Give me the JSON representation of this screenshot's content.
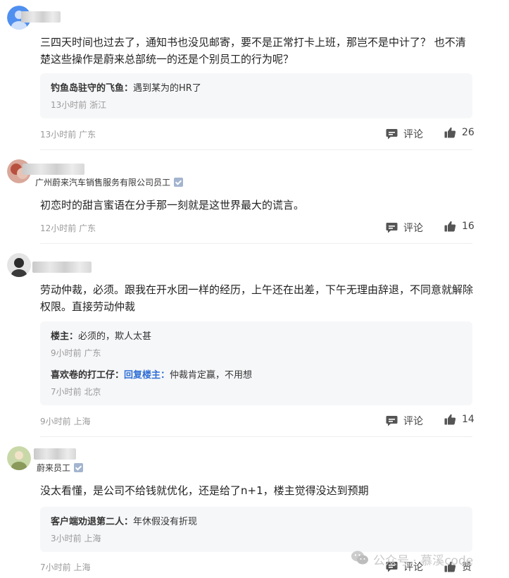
{
  "comments": [
    {
      "company": "",
      "verified": false,
      "content": "三四天时间也过去了，通知书也没见邮寄，要不是正常打卡上班，那岂不是中计了？ 也不清楚这些操作是蔚来总部统一的还是个别员工的行为呢？",
      "replies": [
        {
          "author": "钓鱼岛驻守的飞鱼：",
          "reply_to": "",
          "text": "遇到某为的HR了",
          "time": "13小时前",
          "location": "浙江"
        }
      ],
      "time": "13小时前",
      "location": "广东",
      "comment_label": "评论",
      "like_count": "26"
    },
    {
      "company": "广州蔚来汽车销售服务有限公司员工",
      "verified": true,
      "content": "初恋时的甜言蜜语在分手那一刻就是这世界最大的谎言。",
      "replies": [],
      "time": "12小时前",
      "location": "广东",
      "comment_label": "评论",
      "like_count": "16"
    },
    {
      "company": "",
      "verified": false,
      "content": "劳动仲裁，必须。跟我在开水团一样的经历，上午还在出差，下午无理由辞退，不同意就解除权限。直接劳动仲裁",
      "replies": [
        {
          "author": "楼主：",
          "reply_to": "",
          "text": "必须的，欺人太甚",
          "time": "9小时前",
          "location": "广东"
        },
        {
          "author": "喜欢卷的打工仔：",
          "reply_to": "回复楼主：",
          "text": "仲裁肯定赢，不用想",
          "time": "7小时前",
          "location": "北京"
        }
      ],
      "time": "9小时前",
      "location": "上海",
      "comment_label": "评论",
      "like_count": "14"
    },
    {
      "company": "蔚来员工",
      "verified": true,
      "content": "没太看懂，是公司不给钱就优化，还是给了n+1，楼主觉得没达到预期",
      "replies": [
        {
          "author": "客户端劝退第二人：",
          "reply_to": "",
          "text": "年休假没有折现",
          "time": "3小时前",
          "location": "上海"
        }
      ],
      "time": "7小时前",
      "location": "上海",
      "comment_label": "评论",
      "like_label": "赞"
    }
  ],
  "watermark": "公众号 · 慕溪code",
  "colors": {
    "accent_link": "#2f6fd6",
    "meta_gray": "#9a9a9a",
    "reply_bg": "#f6f7f9"
  },
  "icons": {
    "comment": "comment-bubble-icon",
    "like": "thumbs-up-icon",
    "verify": "verified-badge-icon",
    "watermark": "wechat-icon"
  }
}
